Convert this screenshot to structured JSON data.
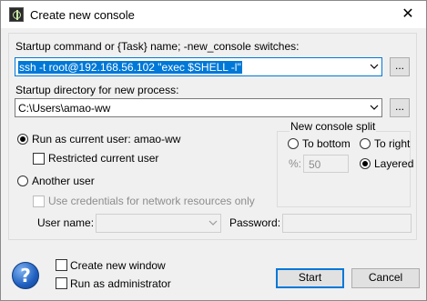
{
  "window": {
    "title": "Create new console"
  },
  "command": {
    "label": "Startup command or {Task} name; -new_console switches:",
    "value": "ssh -t root@192.168.56.102 \"exec $SHELL -l\"",
    "browse_label": "..."
  },
  "directory": {
    "label": "Startup directory for new process:",
    "value": "C:\\Users\\amao-ww",
    "browse_label": "..."
  },
  "run_as": {
    "current_user_label": "Run as current user: amao-ww",
    "restricted_label": "Restricted current user",
    "another_user_label": "Another user",
    "use_credentials_label": "Use credentials for network resources only",
    "user_name_label": "User name:",
    "password_label": "Password:"
  },
  "split": {
    "title": "New console split",
    "to_bottom_label": "To bottom",
    "to_right_label": "To right",
    "percent_label": "%:",
    "percent_value": "50",
    "layered_label": "Layered"
  },
  "footer": {
    "help_glyph": "?",
    "create_window_label": "Create new window",
    "run_admin_label": "Run as administrator",
    "start_label": "Start",
    "cancel_label": "Cancel"
  }
}
